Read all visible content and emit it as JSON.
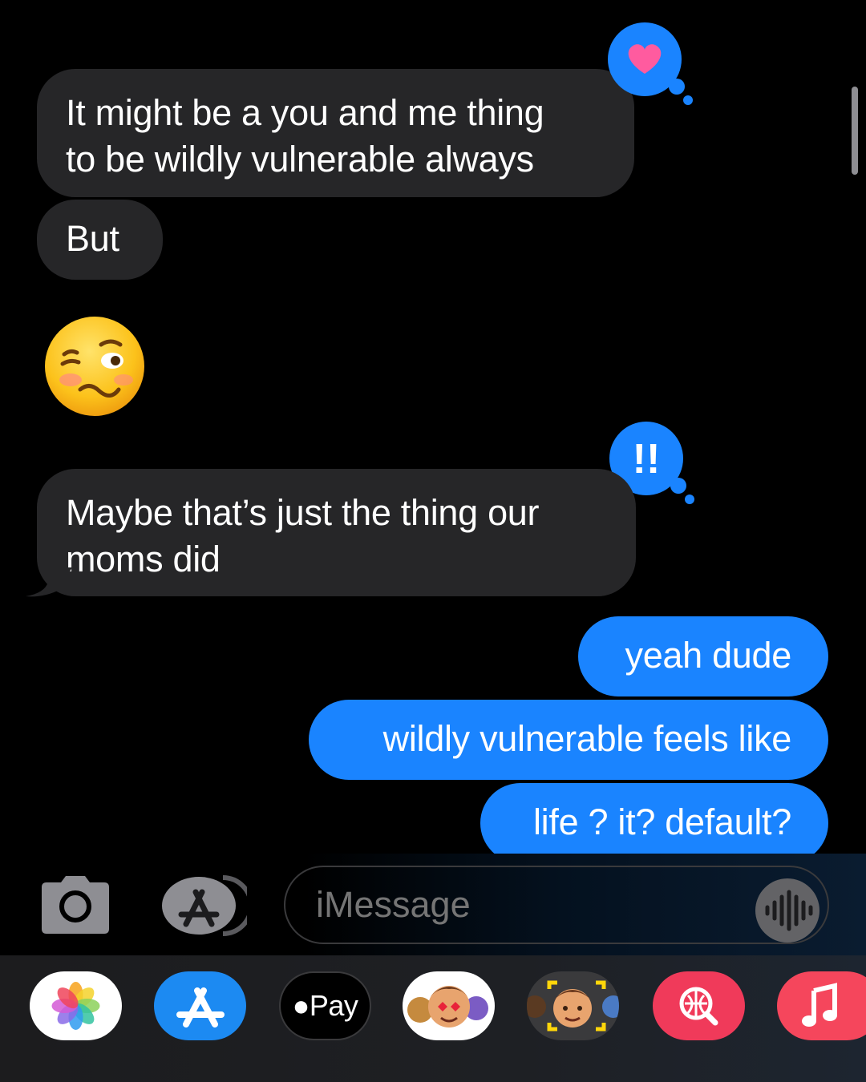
{
  "messages": [
    {
      "from": "them",
      "lines": [
        "It might be a you and me thing",
        "to be wildly vulnerable always"
      ],
      "tapback": "heart"
    },
    {
      "from": "them",
      "lines": [
        "But"
      ]
    },
    {
      "from": "them",
      "emoji": "woozy-face-emoji"
    },
    {
      "from": "them",
      "lines": [
        "Maybe that’s just the thing our",
        "moms did"
      ],
      "tapback": "exclamation"
    },
    {
      "from": "me",
      "lines": [
        "yeah dude"
      ]
    },
    {
      "from": "me",
      "lines": [
        "wildly vulnerable feels like"
      ]
    },
    {
      "from": "me",
      "lines": [
        "life ? it? default?"
      ]
    }
  ],
  "compose": {
    "placeholder": "iMessage"
  },
  "tapbacks": {
    "heart": "!!",
    "exclamation": "!!"
  },
  "app_tray": {
    "items": [
      "photos-app-icon",
      "app-store-icon",
      "apple-pay-icon",
      "memoji-stickers-icon",
      "memoji-camera-icon",
      "web-search-icon",
      "music-app-icon"
    ],
    "pay_label": "Pay"
  },
  "colors": {
    "incoming": "#262628",
    "outgoing": "#1a84ff",
    "background": "#000000",
    "heart": "#ff5b9f"
  }
}
